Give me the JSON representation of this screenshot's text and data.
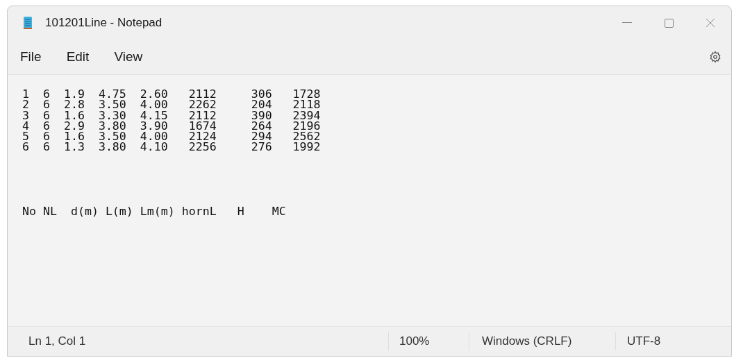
{
  "window": {
    "title": "101201Line - Notepad"
  },
  "menu": [
    "File",
    "Edit",
    "View"
  ],
  "document": {
    "lines": [
      "1  6  1.9  4.75  2.60   2112     306   1728",
      "2  6  2.8  3.50  4.00   2262     204   2118",
      "3  6  1.6  3.30  4.15   2112     390   2394",
      "4  6  2.9  3.80  3.90   1674     264   2196",
      "5  6  1.6  3.50  4.00   2124     294   2562",
      "6  6  1.3  3.80  4.10   2256     276   1992"
    ],
    "footer_line": "No NL  d(m) L(m) Lm(m) hornL   H    MC"
  },
  "status_bar": {
    "position": "Ln 1, Col 1",
    "zoom": "100%",
    "line_ending": "Windows (CRLF)",
    "encoding": "UTF-8"
  }
}
